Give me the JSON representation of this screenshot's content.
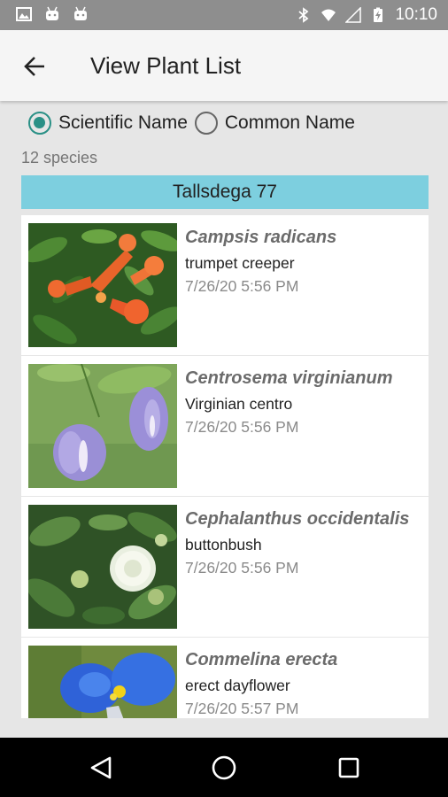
{
  "status_bar": {
    "time": "10:10",
    "left_icons": [
      "image-icon",
      "android-icon",
      "android-icon"
    ],
    "right_icons": [
      "bluetooth-icon",
      "wifi-icon",
      "signal-icon",
      "battery-charging-icon"
    ]
  },
  "app_bar": {
    "back_icon": "arrow-left-icon",
    "title": "View Plant List"
  },
  "name_mode": {
    "options": [
      {
        "label": "Scientific Name",
        "checked": true
      },
      {
        "label": "Common Name",
        "checked": false
      }
    ]
  },
  "species_count": "12 species",
  "list_header": "Tallsdega 77",
  "plants": [
    {
      "scientific": "Campsis radicans",
      "common": "trumpet creeper",
      "date": "7/26/20 5:56 PM",
      "image": "photo-trumpet-creeper"
    },
    {
      "scientific": "Centrosema virginianum",
      "common": "Virginian centro",
      "date": "7/26/20 5:56 PM",
      "image": "photo-centrosema"
    },
    {
      "scientific": "Cephalanthus occidentalis",
      "common": "buttonbush",
      "date": "7/26/20 5:56 PM",
      "image": "photo-buttonbush"
    },
    {
      "scientific": "Commelina erecta",
      "common": "erect dayflower",
      "date": "7/26/20 5:57 PM",
      "image": "photo-dayflower"
    }
  ],
  "nav_bar": {
    "buttons": [
      "back-triangle-icon",
      "home-circle-icon",
      "recents-square-icon"
    ]
  },
  "colors": {
    "accent": "#2a9086",
    "header_band": "#7dcfdf",
    "status_bar": "#8e8e8e",
    "app_bar": "#f5f5f5"
  }
}
